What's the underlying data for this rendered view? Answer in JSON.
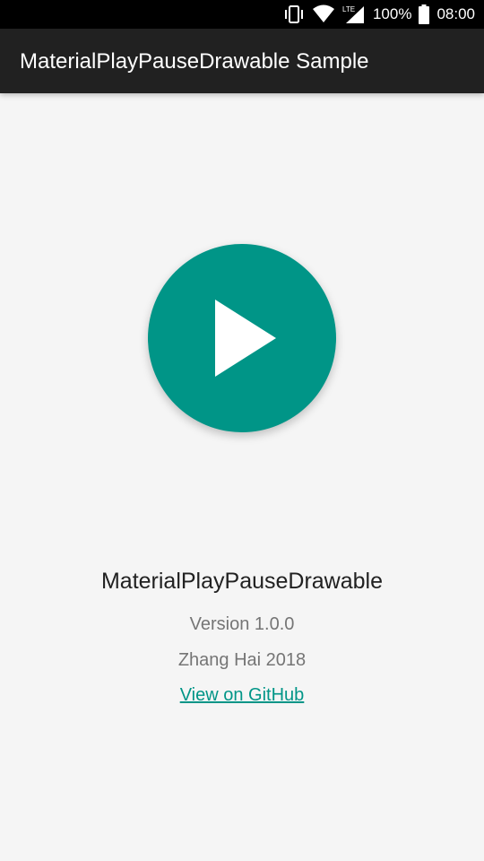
{
  "status_bar": {
    "battery_percent": "100%",
    "time": "08:00",
    "network_label": "LTE",
    "icons": [
      "vibrate-icon",
      "wifi-icon",
      "lte-signal-icon",
      "battery-icon"
    ]
  },
  "app_bar": {
    "title": "MaterialPlayPauseDrawable Sample"
  },
  "player": {
    "state": "paused",
    "icon": "play-icon",
    "button_color": "#009587"
  },
  "info": {
    "library_name": "MaterialPlayPauseDrawable",
    "version": "Version 1.0.0",
    "author": "Zhang Hai 2018",
    "github_link": "View on GitHub"
  },
  "colors": {
    "accent": "#009587",
    "app_bar": "#212121",
    "background": "#f5f5f5"
  }
}
